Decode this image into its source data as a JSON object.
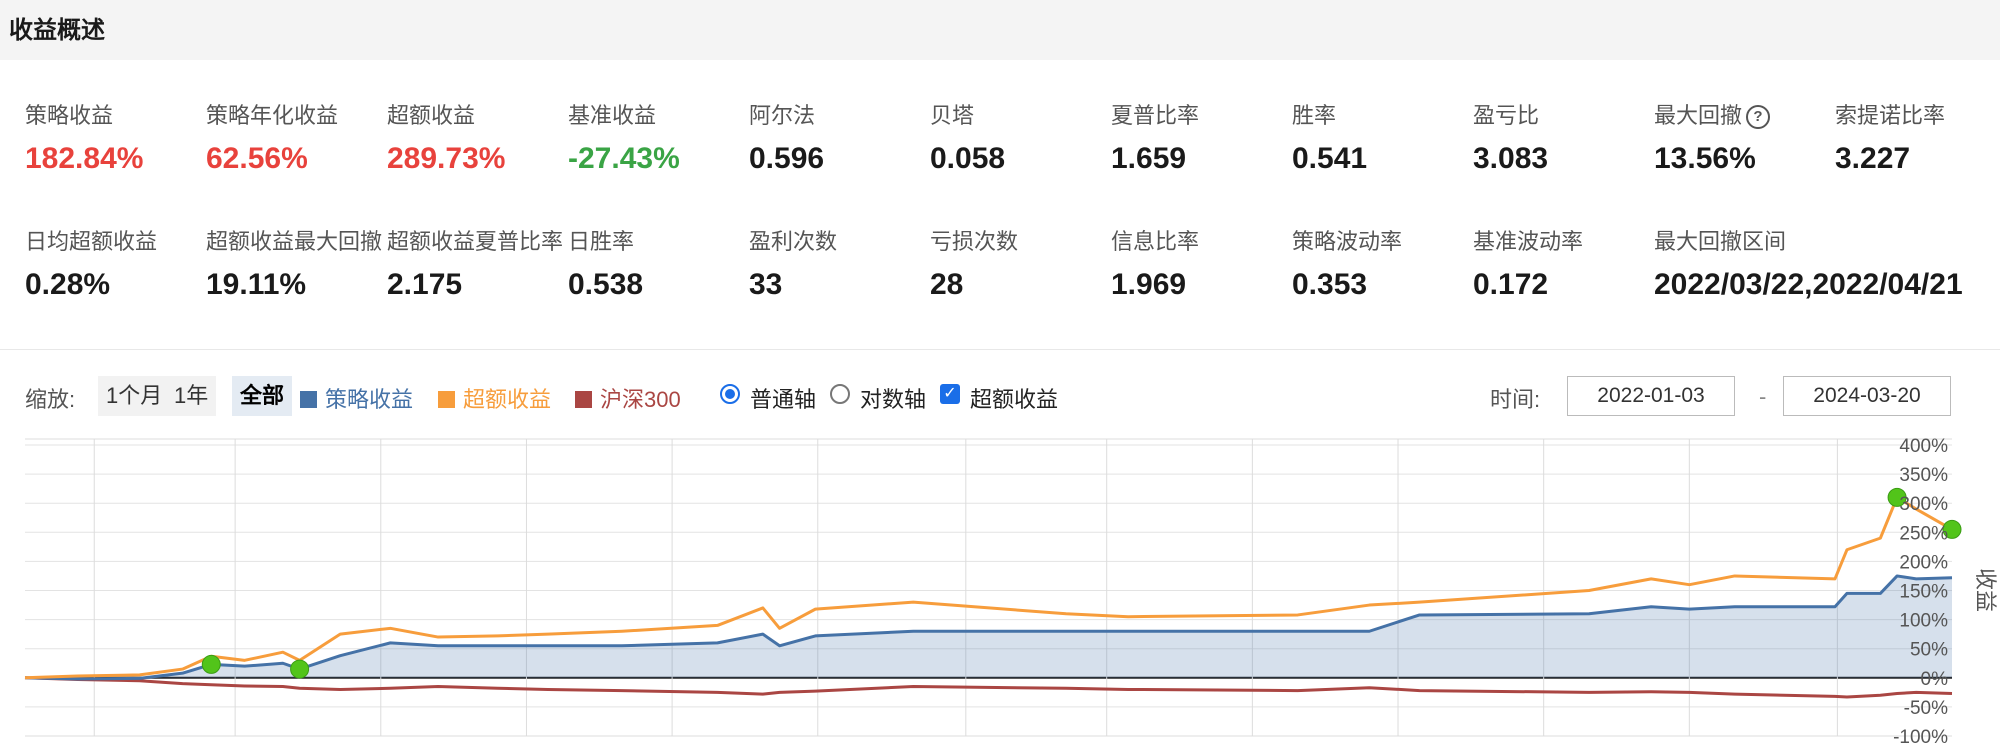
{
  "header": {
    "title": "收益概述"
  },
  "metrics_row1": [
    {
      "label": "策略收益",
      "value": "182.84%",
      "tone": "red"
    },
    {
      "label": "策略年化收益",
      "value": "62.56%",
      "tone": "red"
    },
    {
      "label": "超额收益",
      "value": "289.73%",
      "tone": "red"
    },
    {
      "label": "基准收益",
      "value": "-27.43%",
      "tone": "green"
    },
    {
      "label": "阿尔法",
      "value": "0.596",
      "tone": "normal"
    },
    {
      "label": "贝塔",
      "value": "0.058",
      "tone": "normal"
    },
    {
      "label": "夏普比率",
      "value": "1.659",
      "tone": "normal"
    },
    {
      "label": "胜率",
      "value": "0.541",
      "tone": "normal"
    },
    {
      "label": "盈亏比",
      "value": "3.083",
      "tone": "normal"
    },
    {
      "label": "最大回撤",
      "value": "13.56%",
      "tone": "normal",
      "help": true
    },
    {
      "label": "索提诺比率",
      "value": "3.227",
      "tone": "normal"
    }
  ],
  "metrics_row2": [
    {
      "label": "日均超额收益",
      "value": "0.28%"
    },
    {
      "label": "超额收益最大回撤",
      "value": "19.11%"
    },
    {
      "label": "超额收益夏普比率",
      "value": "2.175"
    },
    {
      "label": "日胜率",
      "value": "0.538"
    },
    {
      "label": "盈利次数",
      "value": "33"
    },
    {
      "label": "亏损次数",
      "value": "28"
    },
    {
      "label": "信息比率",
      "value": "1.969"
    },
    {
      "label": "策略波动率",
      "value": "0.353"
    },
    {
      "label": "基准波动率",
      "value": "0.172"
    },
    {
      "label": "最大回撤区间",
      "value": "2022/03/22,2022/04/21"
    }
  ],
  "toolbar": {
    "zoom_label": "缩放:",
    "zoom_1m": "1个月",
    "zoom_1y": "1年",
    "zoom_all": "全部",
    "legend_strategy": "策略收益",
    "legend_excess": "超额收益",
    "legend_benchmark": "沪深300",
    "axis_normal": "普通轴",
    "axis_log": "对数轴",
    "excess_checkbox": "超额收益",
    "time_label": "时间:",
    "date_start": "2022-01-03",
    "date_sep": "-",
    "date_end": "2024-03-20"
  },
  "colors": {
    "strategy": "#4572a7",
    "excess": "#f79d3c",
    "benchmark": "#aa4643",
    "red": "#e8423c",
    "green": "#3aa445",
    "marker": "#52c41a"
  },
  "chart_data": {
    "type": "line",
    "ylabel": "收益",
    "yticks": [
      400,
      350,
      300,
      250,
      200,
      150,
      100,
      50,
      0,
      -50,
      -100
    ],
    "ylim": [
      -100,
      400
    ],
    "x_start": "2022-01-03",
    "x_end": "2024-03-20",
    "legend_position": "top",
    "grid": true,
    "series": [
      {
        "name": "策略收益",
        "color": "#4572a7",
        "area": true,
        "x": [
          "2022-01-03",
          "2022-01-25",
          "2022-02-20",
          "2022-03-10",
          "2022-03-22",
          "2022-04-05",
          "2022-04-21",
          "2022-04-28",
          "2022-05-15",
          "2022-06-05",
          "2022-06-25",
          "2022-07-20",
          "2022-08-10",
          "2022-09-10",
          "2022-10-20",
          "2022-11-08",
          "2022-11-15",
          "2022-11-30",
          "2023-01-10",
          "2023-03-15",
          "2023-04-10",
          "2023-06-20",
          "2023-07-20",
          "2023-08-10",
          "2023-10-20",
          "2023-11-15",
          "2023-12-01",
          "2023-12-20",
          "2024-01-31",
          "2024-02-05",
          "2024-02-19",
          "2024-02-26",
          "2024-03-05",
          "2024-03-20"
        ],
        "values": [
          0,
          -2,
          -1,
          8,
          23,
          20,
          25,
          15,
          38,
          60,
          55,
          55,
          55,
          55,
          60,
          75,
          55,
          72,
          80,
          80,
          80,
          80,
          80,
          108,
          110,
          122,
          118,
          122,
          122,
          145,
          145,
          175,
          170,
          172
        ]
      },
      {
        "name": "超额收益",
        "color": "#f79d3c",
        "x": [
          "2022-01-03",
          "2022-01-25",
          "2022-02-20",
          "2022-03-10",
          "2022-03-22",
          "2022-04-05",
          "2022-04-21",
          "2022-04-28",
          "2022-05-15",
          "2022-06-05",
          "2022-06-25",
          "2022-07-20",
          "2022-08-10",
          "2022-09-10",
          "2022-10-20",
          "2022-11-08",
          "2022-11-15",
          "2022-11-30",
          "2023-01-10",
          "2023-03-15",
          "2023-04-10",
          "2023-06-20",
          "2023-07-20",
          "2023-08-10",
          "2023-10-20",
          "2023-11-15",
          "2023-12-01",
          "2023-12-20",
          "2024-01-31",
          "2024-02-05",
          "2024-02-19",
          "2024-02-26",
          "2024-03-05",
          "2024-03-20"
        ],
        "values": [
          0,
          3,
          5,
          15,
          37,
          30,
          44,
          30,
          75,
          85,
          70,
          72,
          75,
          80,
          90,
          120,
          85,
          118,
          130,
          110,
          105,
          108,
          125,
          130,
          150,
          170,
          160,
          175,
          170,
          220,
          240,
          310,
          290,
          255
        ]
      },
      {
        "name": "沪深300",
        "color": "#aa4643",
        "x": [
          "2022-01-03",
          "2022-01-25",
          "2022-02-20",
          "2022-03-10",
          "2022-03-22",
          "2022-04-05",
          "2022-04-21",
          "2022-04-28",
          "2022-05-15",
          "2022-06-05",
          "2022-06-25",
          "2022-07-20",
          "2022-08-10",
          "2022-09-10",
          "2022-10-20",
          "2022-11-08",
          "2022-11-15",
          "2022-11-30",
          "2023-01-10",
          "2023-03-15",
          "2023-04-10",
          "2023-06-20",
          "2023-07-20",
          "2023-08-10",
          "2023-10-20",
          "2023-11-15",
          "2023-12-01",
          "2023-12-20",
          "2024-01-31",
          "2024-02-05",
          "2024-02-19",
          "2024-02-26",
          "2024-03-05",
          "2024-03-20"
        ],
        "values": [
          0,
          -3,
          -5,
          -10,
          -12,
          -14,
          -15,
          -18,
          -20,
          -18,
          -15,
          -18,
          -20,
          -22,
          -25,
          -28,
          -25,
          -23,
          -15,
          -18,
          -20,
          -22,
          -17,
          -22,
          -25,
          -24,
          -25,
          -28,
          -32,
          -33,
          -30,
          -27,
          -25,
          -27
        ]
      }
    ],
    "markers": [
      {
        "x": "2022-03-22",
        "y": 23
      },
      {
        "x": "2022-04-28",
        "y": 15
      },
      {
        "x": "2024-02-26",
        "y": 310
      },
      {
        "x": "2024-03-20",
        "y": 255
      }
    ]
  }
}
